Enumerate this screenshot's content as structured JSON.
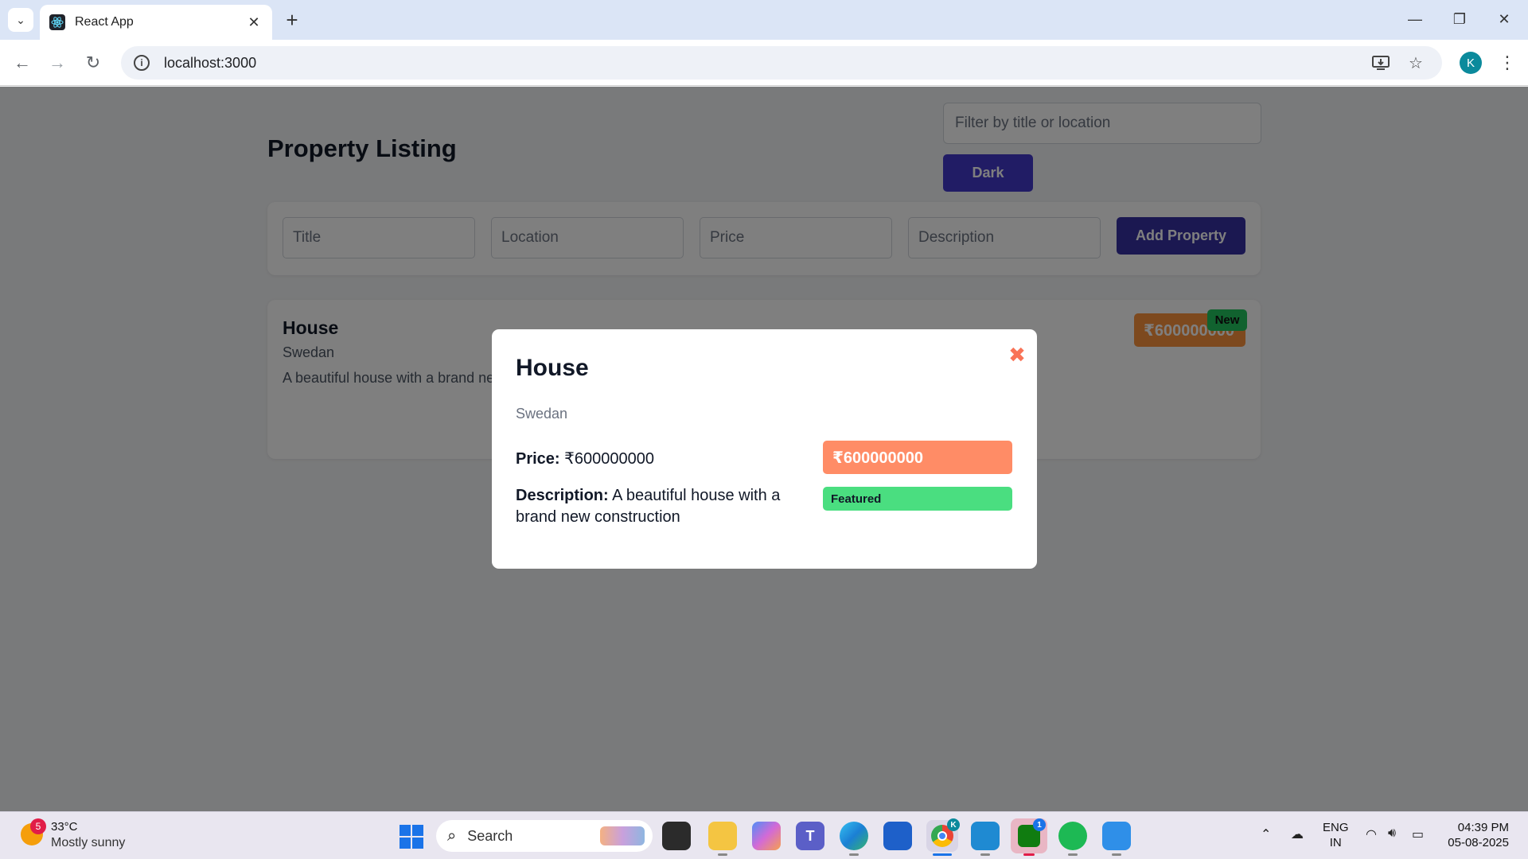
{
  "browser": {
    "tab_title": "React App",
    "url": "localhost:3000",
    "profile_initial": "K"
  },
  "page": {
    "title": "Property Listing",
    "filter_placeholder": "Filter by title or location",
    "theme_button": "Dark",
    "form": {
      "title_placeholder": "Title",
      "location_placeholder": "Location",
      "price_placeholder": "Price",
      "description_placeholder": "Description",
      "add_button": "Add Property"
    },
    "listing": {
      "title": "House",
      "location": "Swedan",
      "description": "A beautiful house with a brand new construction",
      "price": "₹600000000",
      "badge": "New"
    }
  },
  "modal": {
    "title": "House",
    "close_glyph": "✖",
    "location": "Swedan",
    "price_label": "Price:",
    "price_value": "₹600000000",
    "description_label": "Description:",
    "description_value": "A beautiful house with a brand new construction",
    "price_badge": "₹600000000",
    "featured_badge": "Featured"
  },
  "taskbar": {
    "weather_temp": "33°C",
    "weather_desc": "Mostly sunny",
    "weather_badge": "5",
    "search_label": "Search",
    "lang_line1": "ENG",
    "lang_line2": "IN",
    "time": "04:39 PM",
    "date": "05-08-2025",
    "chrome_badge": "K",
    "xbox_badge": "1"
  },
  "colors": {
    "accent_button": "#4338ca",
    "price_badge": "#ff8c66",
    "featured_badge": "#4ade80",
    "close_icon": "#f97357"
  }
}
